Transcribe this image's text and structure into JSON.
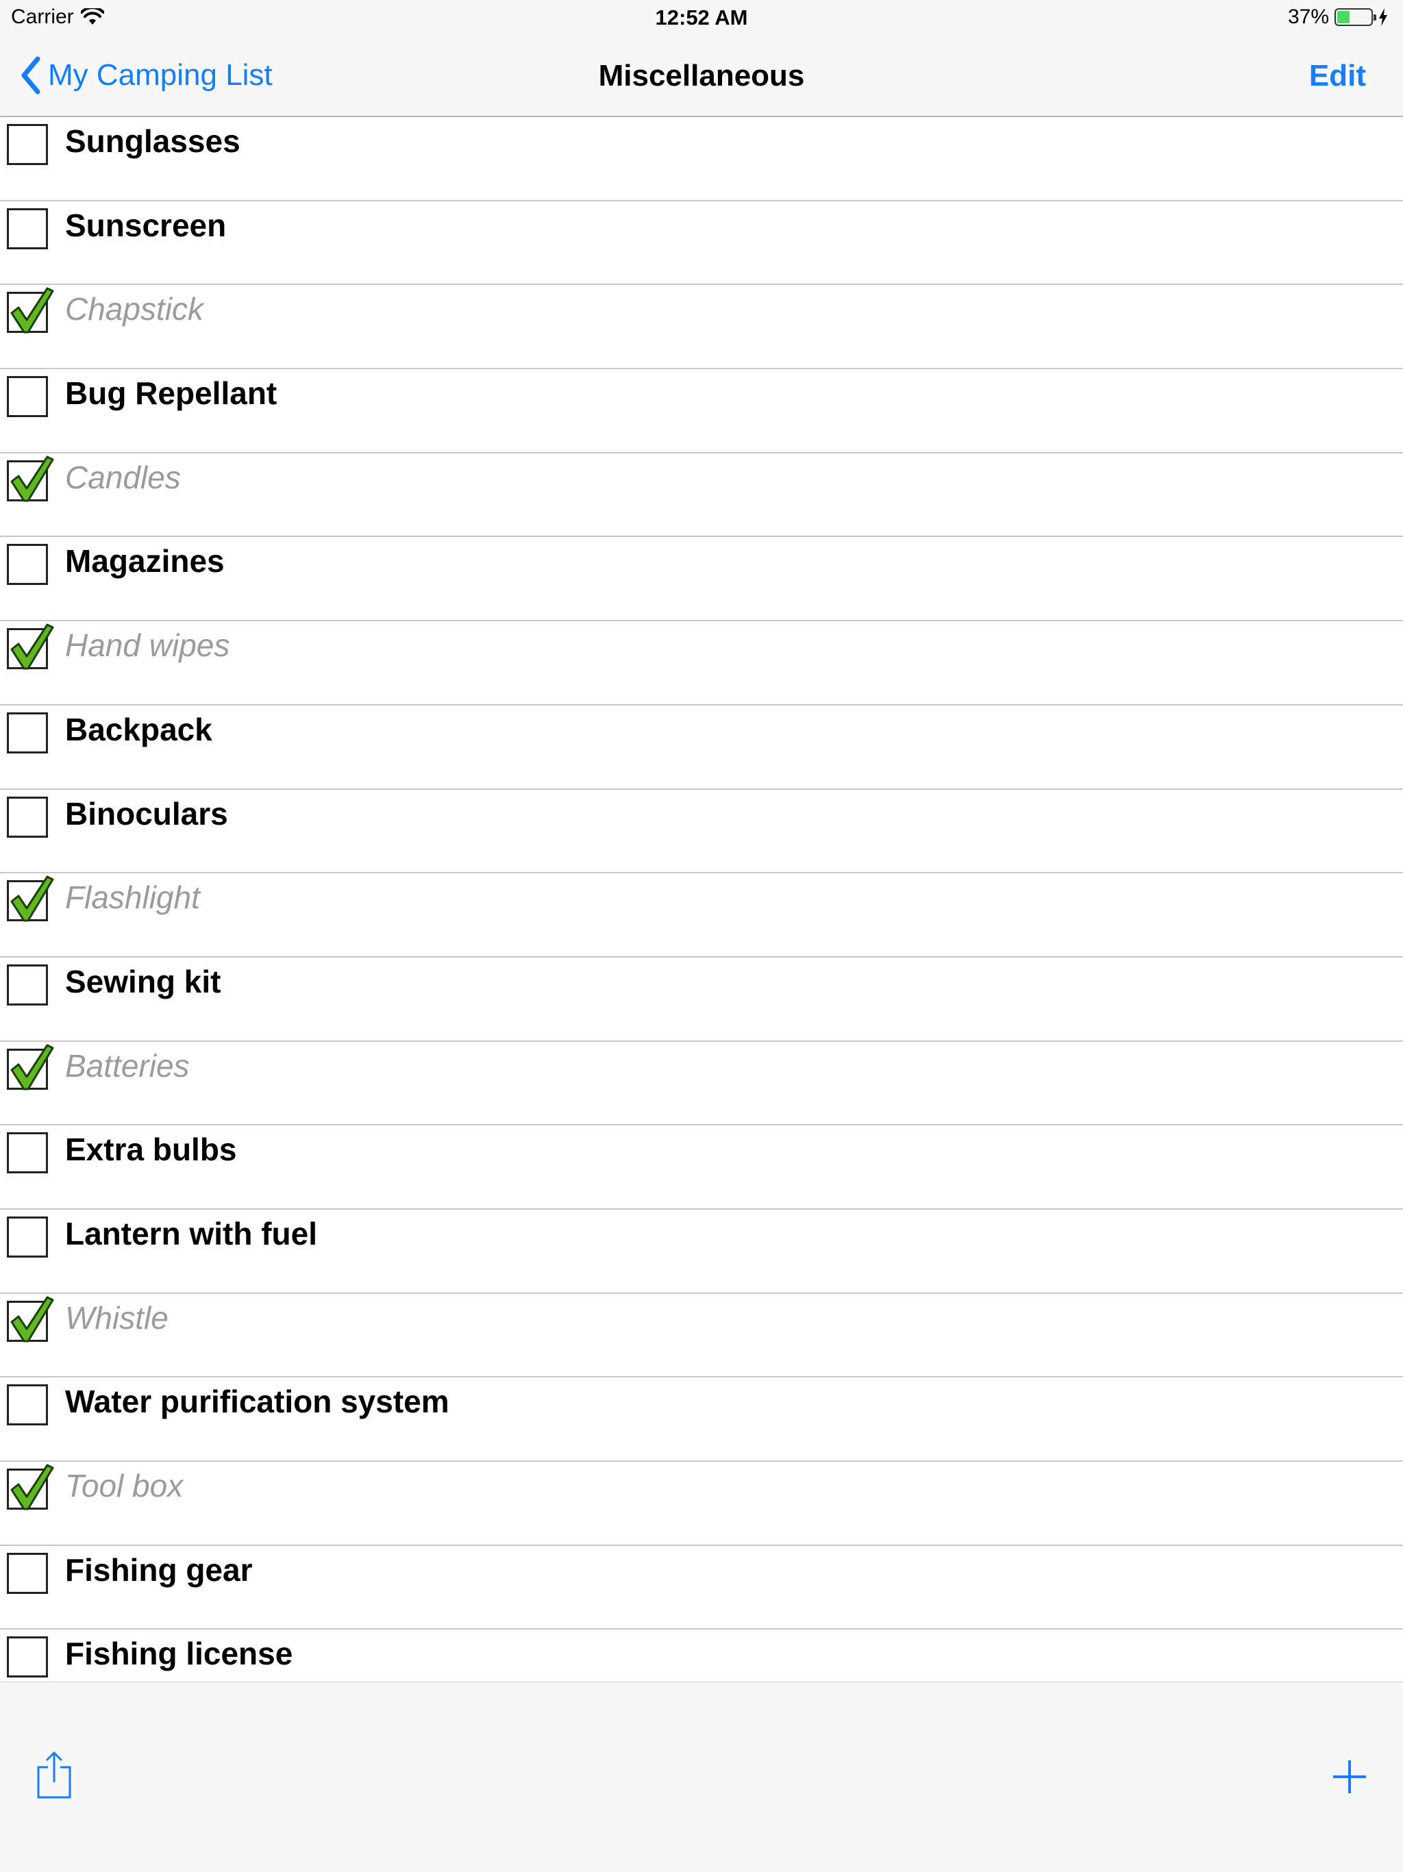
{
  "status_bar": {
    "carrier": "Carrier",
    "time": "12:52 AM",
    "battery": "37%",
    "battery_level": 0.37
  },
  "nav": {
    "back_label": "My Camping List",
    "title": "Miscellaneous",
    "edit_label": "Edit"
  },
  "items": [
    {
      "label": "Sunglasses",
      "checked": false
    },
    {
      "label": "Sunscreen",
      "checked": false
    },
    {
      "label": "Chapstick",
      "checked": true
    },
    {
      "label": "Bug Repellant",
      "checked": false
    },
    {
      "label": "Candles",
      "checked": true
    },
    {
      "label": "Magazines",
      "checked": false
    },
    {
      "label": "Hand wipes",
      "checked": true
    },
    {
      "label": "Backpack",
      "checked": false
    },
    {
      "label": "Binoculars",
      "checked": false
    },
    {
      "label": "Flashlight",
      "checked": true
    },
    {
      "label": "Sewing kit",
      "checked": false
    },
    {
      "label": "Batteries",
      "checked": true
    },
    {
      "label": "Extra bulbs",
      "checked": false
    },
    {
      "label": "Lantern with fuel",
      "checked": false
    },
    {
      "label": "Whistle",
      "checked": true
    },
    {
      "label": "Water purification system",
      "checked": false
    },
    {
      "label": "Tool box",
      "checked": true
    },
    {
      "label": "Fishing gear",
      "checked": false
    },
    {
      "label": "Fishing license",
      "checked": false
    }
  ],
  "colors": {
    "accent": "#147efb",
    "check_green": "#5fb820",
    "checked_text": "#9b9b9b"
  },
  "icons": {
    "back": "chevron-left-icon",
    "share": "share-icon",
    "add": "plus-icon",
    "wifi": "wifi-icon",
    "battery": "battery-icon",
    "charging": "bolt-icon",
    "check": "checkmark-icon"
  }
}
